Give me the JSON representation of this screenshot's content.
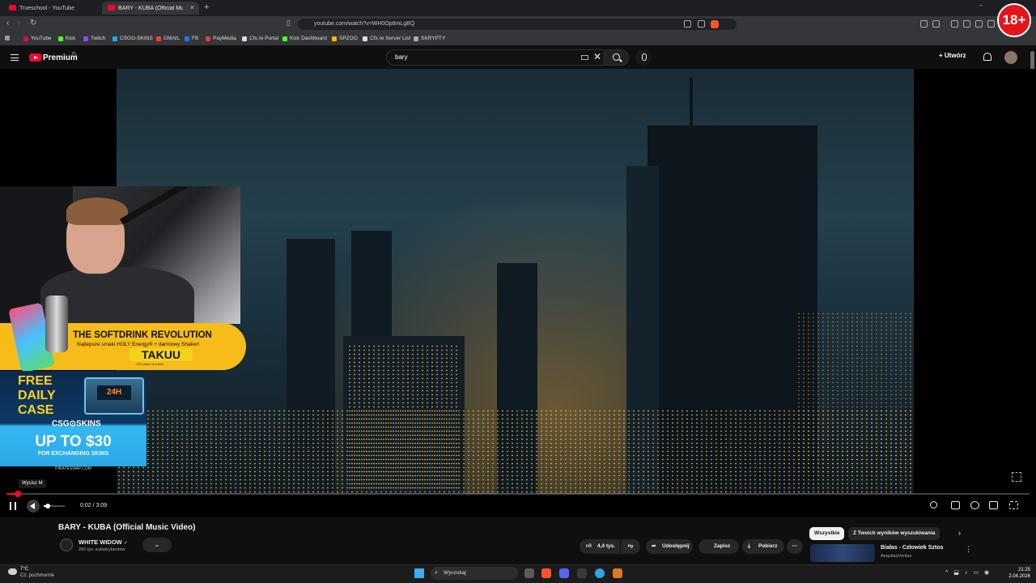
{
  "browser": {
    "tabs": [
      {
        "label": "Trueschool - YouTube",
        "active": false
      },
      {
        "label": "BARY - KUBA (Official Music Video)",
        "active": true
      }
    ],
    "url": "youtube.com/watch?v=WH0Op8mLgBQ",
    "bookmarks": [
      "YouTube",
      "Kick",
      "Twitch",
      "CSGO-SKINS",
      "GMAIL",
      "FB",
      "PayMedia",
      "Cfx.re Portal",
      "Kick Dashboard",
      "SPZOO",
      "Cfx.re Server List",
      "SKRYPTY"
    ]
  },
  "youtube": {
    "brand": "Premium",
    "region": "PL",
    "search_value": "bary",
    "create_label": "Utwórz",
    "age_badge": "18+"
  },
  "overlays": {
    "softdrink": {
      "title": "THE SOFTDRINK REVOLUTION",
      "subtitle": "Najlepsze smaki HOLY Energy® + darmowy Shaker!",
      "brand": "TAKUU",
      "fine": "10% rabatu na kodem"
    },
    "csgo": {
      "free": "FREE",
      "daily": "DAILY",
      "case": "CASE",
      "timer": "24H",
      "logo": "CSG⊙SKINS",
      "upto": "UP TO $30",
      "exchanging": "FOR EXCHANGING SKINS",
      "site": "PIRATESWAP.COM"
    }
  },
  "player": {
    "tooltip": "Wycisz  M",
    "time": "0:02 / 3:09",
    "progress_fraction": 0.011,
    "volume_fraction": 0.2,
    "accent": "#ff0033"
  },
  "video": {
    "title": "BARY - KUBA (Official Music Video)",
    "channel": "WHITE WIDOW",
    "verified": "✓",
    "subscribers": "265 tys. subskrybentów",
    "likes": "4,4 tys.",
    "share": "Udostępnij",
    "save": "Zapisz",
    "download": "Pobierz",
    "more": "⋯"
  },
  "recommendations": {
    "chips": [
      "Wszystkie",
      "Z Twoich wyników wyszukiwania"
    ],
    "first": {
      "title": "Białas - Człowiek Sztos",
      "channel": "AequitasVeritas"
    }
  },
  "taskbar": {
    "temp": "7°C",
    "weather": "Cz. pochmurnie",
    "search": "Wyszukaj",
    "time": "21:25",
    "date": "2.04.2026"
  }
}
